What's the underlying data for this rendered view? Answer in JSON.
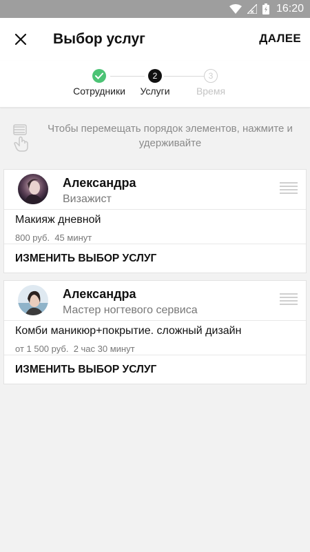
{
  "status_bar": {
    "time": "16:20"
  },
  "app_bar": {
    "title": "Выбор услуг",
    "next_label": "ДАЛЕЕ"
  },
  "stepper": {
    "steps": [
      {
        "label": "Сотрудники",
        "number": "1",
        "state": "done"
      },
      {
        "label": "Услуги",
        "number": "2",
        "state": "active"
      },
      {
        "label": "Время",
        "number": "3",
        "state": "pending"
      }
    ]
  },
  "hint": {
    "text": "Чтобы перемещать порядок элементов, нажмите и удерживайте"
  },
  "cards": [
    {
      "employee_name": "Александра",
      "employee_role": "Визажист",
      "service_name": "Макияж дневной",
      "price": "800 руб.",
      "duration": "45 минут",
      "change_label": "ИЗМЕНИТЬ ВЫБОР УСЛУГ"
    },
    {
      "employee_name": "Александра",
      "employee_role": "Мастер ногтевого сервиса",
      "service_name": "Комби маникюр+покрытие. сложный дизайн",
      "price": "от 1 500 руб.",
      "duration": "2 час 30 минут",
      "change_label": "ИЗМЕНИТЬ ВЫБОР УСЛУГ"
    }
  ],
  "colors": {
    "accent_done": "#4cc375",
    "status_bar": "#9e9e9e"
  }
}
